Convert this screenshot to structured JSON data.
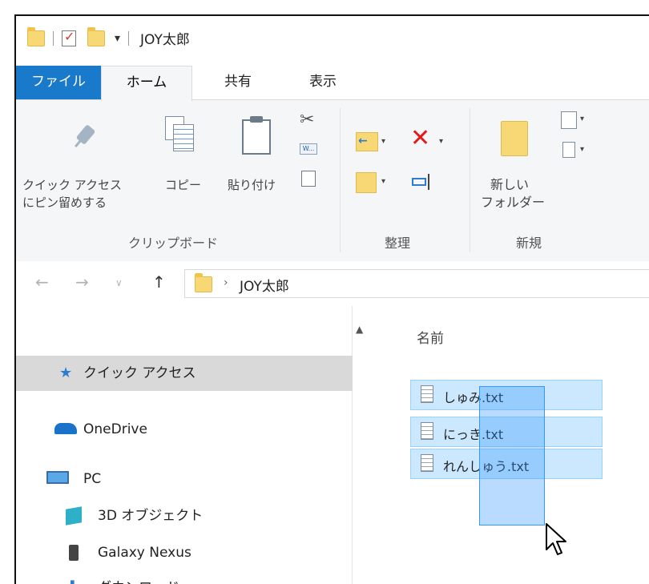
{
  "window": {
    "title": "JOY太郎"
  },
  "tabs": [
    {
      "label": "ファイル"
    },
    {
      "label": "ホーム"
    },
    {
      "label": "共有"
    },
    {
      "label": "表示"
    }
  ],
  "ribbon": {
    "clipboard": {
      "pin_line1": "クイック アクセス",
      "pin_line2": "にピン留めする",
      "copy": "コピー",
      "paste": "貼り付け",
      "group": "クリップボード"
    },
    "organize": {
      "group": "整理"
    },
    "new": {
      "new_folder_line1": "新しい",
      "new_folder_line2": "フォルダー",
      "group": "新規"
    }
  },
  "address": {
    "crumb": "JOY太郎"
  },
  "nav_pane": {
    "items": [
      {
        "label": "クイック アクセス",
        "icon": "star-icon"
      },
      {
        "label": "OneDrive",
        "icon": "cloud-icon"
      },
      {
        "label": "PC",
        "icon": "monitor-icon"
      },
      {
        "label": "3D オブジェクト",
        "icon": "cube-icon"
      },
      {
        "label": "Galaxy Nexus",
        "icon": "phone-icon"
      },
      {
        "label": "ダウンロード",
        "icon": "download-icon"
      }
    ]
  },
  "content": {
    "column_name": "名前",
    "files": [
      {
        "name": "しゅみ.txt"
      },
      {
        "name": "にっき.txt"
      },
      {
        "name": "れんしゅう.txt"
      }
    ]
  },
  "colors": {
    "accent": "#1979ca",
    "selection": "#cce8ff",
    "marquee": "#3399ff",
    "delete": "#e3191b",
    "folder": "#f8d775"
  }
}
